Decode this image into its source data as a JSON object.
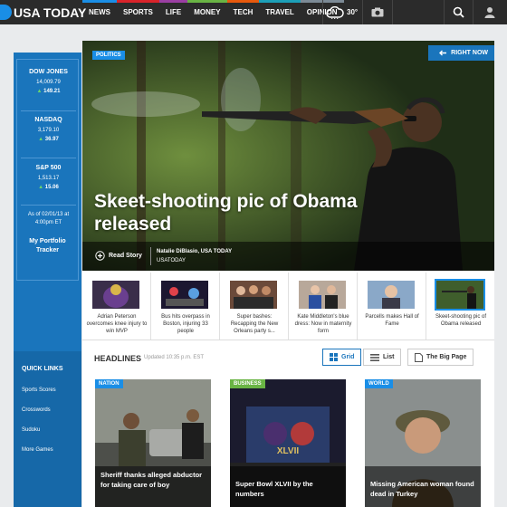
{
  "brand": {
    "logo_text": "USA TODAY"
  },
  "nav": {
    "items": [
      {
        "label": "NEWS",
        "color": "#1a8ee6"
      },
      {
        "label": "SPORTS",
        "color": "#d9232a"
      },
      {
        "label": "LIFE",
        "color": "#9b3fa3"
      },
      {
        "label": "MONEY",
        "color": "#69b444"
      },
      {
        "label": "TECH",
        "color": "#e8590c"
      },
      {
        "label": "TRAVEL",
        "color": "#1c9fb8"
      },
      {
        "label": "OPINION",
        "color": "#7c8a96"
      }
    ],
    "weather_temp": "30°",
    "icons": [
      "cloud-icon",
      "camera-icon",
      "search-icon",
      "user-icon"
    ]
  },
  "sidebar": {
    "stocks": [
      {
        "name": "DOW JONES",
        "value": "14,009.79",
        "change": "149.21"
      },
      {
        "name": "NASDAQ",
        "value": "3,179.10",
        "change": "36.97"
      },
      {
        "name": "S&P 500",
        "value": "1,513.17",
        "change": "15.06"
      }
    ],
    "as_of_line1": "As of 02/01/13 at",
    "as_of_line2": "4:00pm ET",
    "portfolio_line1": "My Portfolio",
    "portfolio_line2": "Tracker",
    "quick_links_title": "QUICK LINKS",
    "quick_links": [
      "Sports Scores",
      "Crosswords",
      "Sudoku",
      "More Games"
    ]
  },
  "hero": {
    "section_tag": "POLITICS",
    "right_now": "RIGHT NOW",
    "title": "Skeet-shooting pic of Obama released",
    "read_story": "Read Story",
    "author": "Natalie DiBlasio, USA TODAY",
    "source": "USATODAY"
  },
  "thumbs": [
    {
      "caption": "Adrian Peterson overcomes knee injury to win MVP"
    },
    {
      "caption": "Bus hits overpass in Boston, injuring 33 people"
    },
    {
      "caption": "Super bashes: Recapping the New Orleans party s..."
    },
    {
      "caption": "Kate Middleton's blue dress: Now in maternity form"
    },
    {
      "caption": "Parcells makes Hall of Fame"
    },
    {
      "caption": "Skeet-shooting pic of Obama released"
    }
  ],
  "headlines": {
    "title": "HEADLINES",
    "updated": "Updated 10:35 p.m. EST",
    "grid_label": "Grid",
    "list_label": "List",
    "big_page_label": "The Big Page"
  },
  "cards": [
    {
      "tag": "NATION",
      "tag_color": "#1a8ee6",
      "title": "Sheriff thanks alleged abductor for taking care of boy"
    },
    {
      "tag": "BUSINESS",
      "tag_color": "#69b444",
      "title": "Super Bowl XLVII by the numbers"
    },
    {
      "tag": "WORLD",
      "tag_color": "#1a8ee6",
      "title": "Missing American woman found dead in Turkey"
    }
  ]
}
